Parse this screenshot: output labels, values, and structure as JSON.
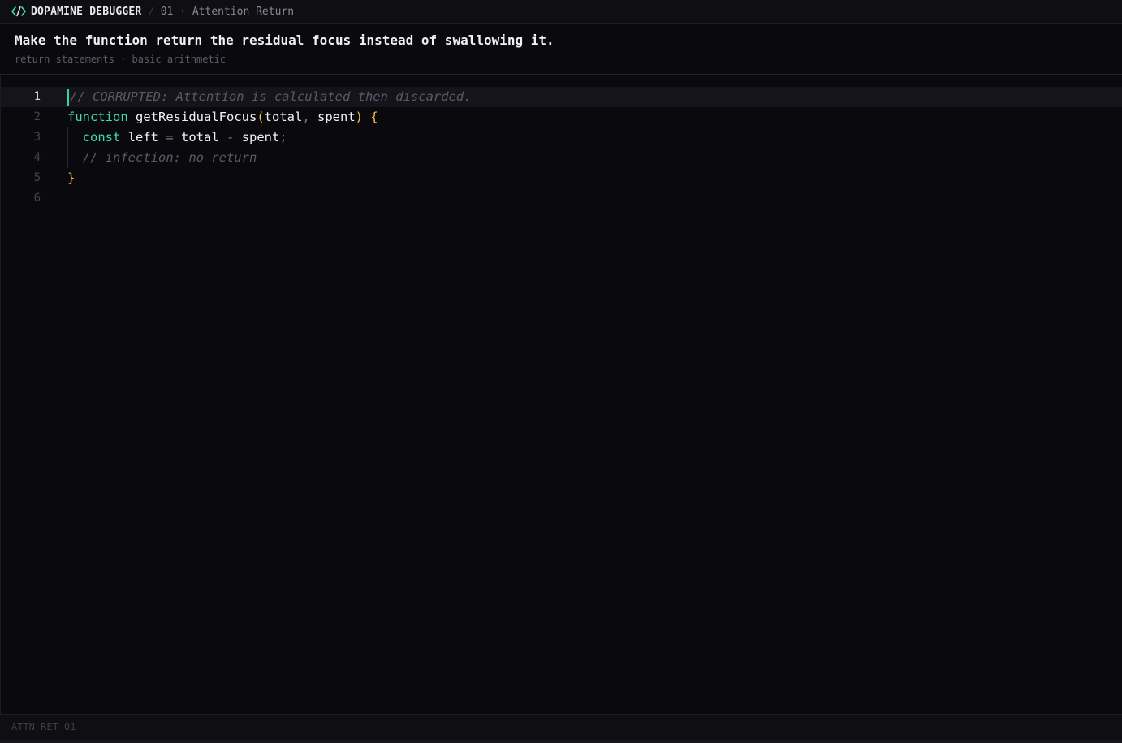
{
  "header": {
    "logo_icon": "code-brackets-icon",
    "brand": "DOPAMINE DEBUGGER",
    "separator": "/",
    "crumb": "01 · Attention Return"
  },
  "task": {
    "title": "Make the function return the residual focus instead of swallowing it.",
    "tags": "return statements · basic arithmetic"
  },
  "editor": {
    "active_line": 1,
    "lines": [
      {
        "num": "1",
        "tokens": [
          {
            "t": "comment",
            "v": "// CORRUPTED: Attention is calculated then discarded."
          }
        ]
      },
      {
        "num": "2",
        "tokens": [
          {
            "t": "keyword",
            "v": "function"
          },
          {
            "t": "ident",
            "v": " "
          },
          {
            "t": "fn",
            "v": "getResidualFocus"
          },
          {
            "t": "paren",
            "v": "("
          },
          {
            "t": "ident",
            "v": "total"
          },
          {
            "t": "punct",
            "v": ","
          },
          {
            "t": "ident",
            "v": " spent"
          },
          {
            "t": "paren",
            "v": ")"
          },
          {
            "t": "ident",
            "v": " "
          },
          {
            "t": "paren",
            "v": "{"
          }
        ]
      },
      {
        "num": "3",
        "tokens": [
          {
            "t": "ident",
            "v": "  "
          },
          {
            "t": "keyword",
            "v": "const"
          },
          {
            "t": "ident",
            "v": " left "
          },
          {
            "t": "op",
            "v": "="
          },
          {
            "t": "ident",
            "v": " total "
          },
          {
            "t": "op",
            "v": "-"
          },
          {
            "t": "ident",
            "v": " spent"
          },
          {
            "t": "punct",
            "v": ";"
          }
        ]
      },
      {
        "num": "4",
        "tokens": [
          {
            "t": "ident",
            "v": "  "
          },
          {
            "t": "comment",
            "v": "// infection: no return"
          }
        ]
      },
      {
        "num": "5",
        "tokens": [
          {
            "t": "paren",
            "v": "}"
          }
        ]
      },
      {
        "num": "6",
        "tokens": []
      }
    ]
  },
  "status": {
    "id": "ATTN_RET_01"
  },
  "colors": {
    "accent": "#3ddbad",
    "bracket": "#f5c542",
    "comment": "#5a5a66",
    "background": "#0a0a0e"
  }
}
